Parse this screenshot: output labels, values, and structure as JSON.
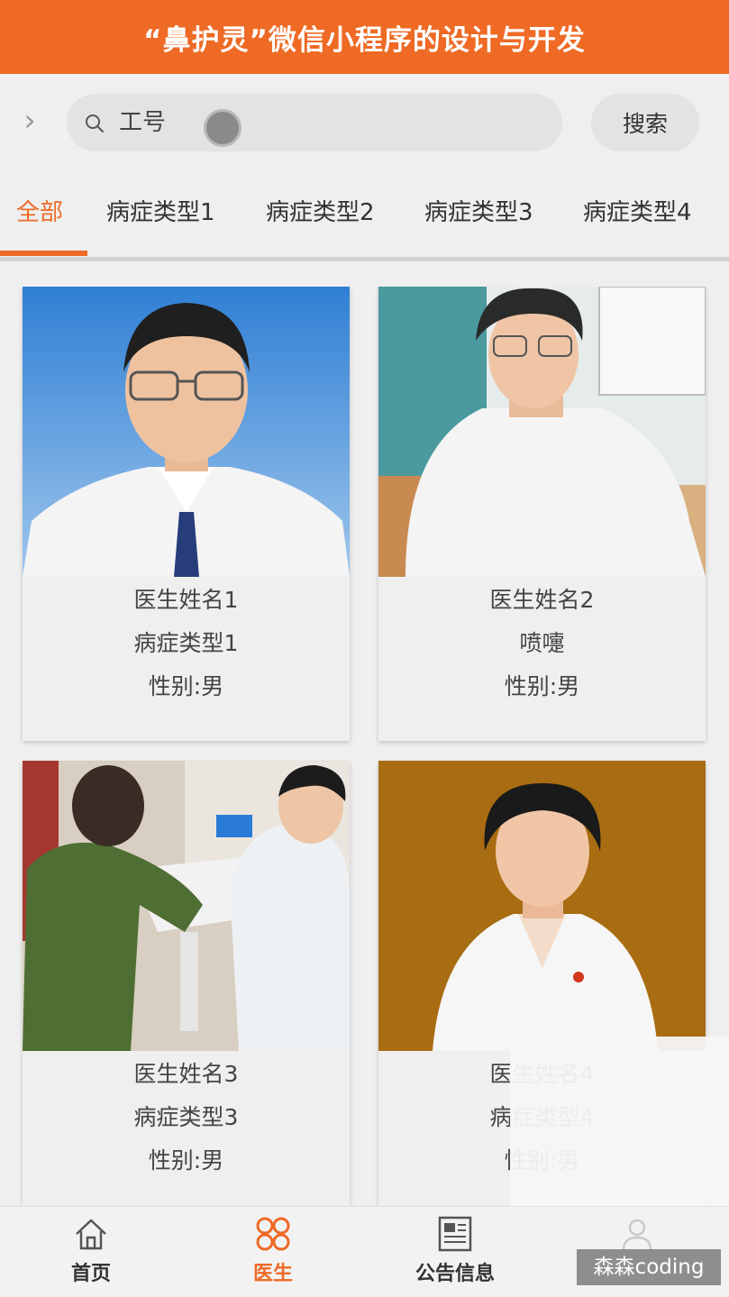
{
  "header": {
    "title": "“鼻护灵”微信小程序的设计与开发"
  },
  "search": {
    "chevron": "›",
    "placeholder": "工号",
    "value": "",
    "button_label": "搜索"
  },
  "tabs": [
    {
      "label": "全部",
      "active": true
    },
    {
      "label": "病症类型1",
      "active": false
    },
    {
      "label": "病症类型2",
      "active": false
    },
    {
      "label": "病症类型3",
      "active": false
    },
    {
      "label": "病症类型4",
      "active": false
    }
  ],
  "doctors": [
    {
      "name": "医生姓名1",
      "disease": "病症类型1",
      "gender": "性别:男"
    },
    {
      "name": "医生姓名2",
      "disease": "喷嚏",
      "gender": "性别:男"
    },
    {
      "name": "医生姓名3",
      "disease": "病症类型3",
      "gender": "性别:男"
    },
    {
      "name": "医生姓名4",
      "disease": "病症类型4",
      "gender": "性别:男"
    }
  ],
  "bottom_nav": [
    {
      "label": "首页",
      "icon": "home-icon",
      "active": false
    },
    {
      "label": "医生",
      "icon": "grid-icon",
      "active": true
    },
    {
      "label": "公告信息",
      "icon": "newspaper-icon",
      "active": false
    },
    {
      "label": "",
      "icon": "user-icon",
      "active": false
    }
  ],
  "watermark": "森森coding",
  "colors": {
    "accent": "#ee6a25",
    "background": "#efefef"
  }
}
